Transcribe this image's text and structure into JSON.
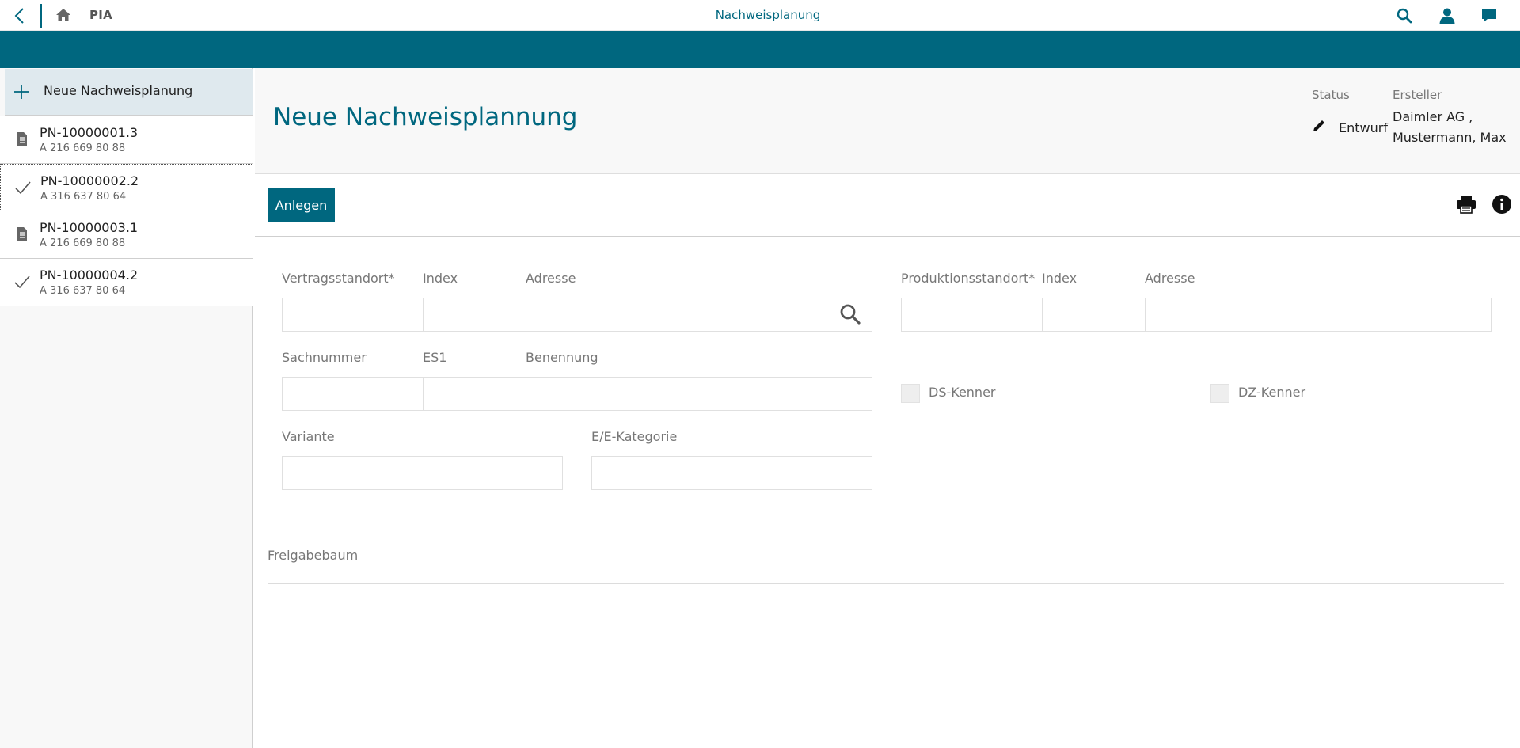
{
  "topbar": {
    "app_name": "PIA",
    "title": "Nachweisplanung"
  },
  "sidebar": {
    "new_label": "Neue Nachweisplanung",
    "items": [
      {
        "id": "PN-10000001.3",
        "part": "A 216 669 80 88",
        "icon": "document-icon"
      },
      {
        "id": "PN-10000002.2",
        "part": "A 316 637 80 64",
        "icon": "check-icon"
      },
      {
        "id": "PN-10000003.1",
        "part": "A 216 669 80 88",
        "icon": "document-icon"
      },
      {
        "id": "PN-10000004.2",
        "part": "A 316 637 80 64",
        "icon": "check-icon"
      }
    ]
  },
  "header": {
    "title": "Neue Nachweisplannung",
    "status_label": "Status",
    "status_value": "Entwurf",
    "creator_label": "Ersteller",
    "creator_line1": "Daimler AG ,",
    "creator_line2": "Mustermann, Max"
  },
  "toolbar": {
    "create_label": "Anlegen"
  },
  "form": {
    "vertragsstandort": "Vertragsstandort*",
    "index1": "Index",
    "adresse1": "Adresse",
    "produktionsstandort": "Produktionsstandort*",
    "index2": "Index",
    "adresse2": "Adresse",
    "sachnummer": "Sachnummer",
    "es1": "ES1",
    "benennung": "Benennung",
    "ds_kenner": "DS-Kenner",
    "dz_kenner": "DZ-Kenner",
    "variante": "Variante",
    "ee_kategorie": "E/E-Kategorie",
    "freigabebaum": "Freigabebaum"
  },
  "colors": {
    "accent": "#00677f",
    "sidebar_selected": "#dfe9ee"
  }
}
